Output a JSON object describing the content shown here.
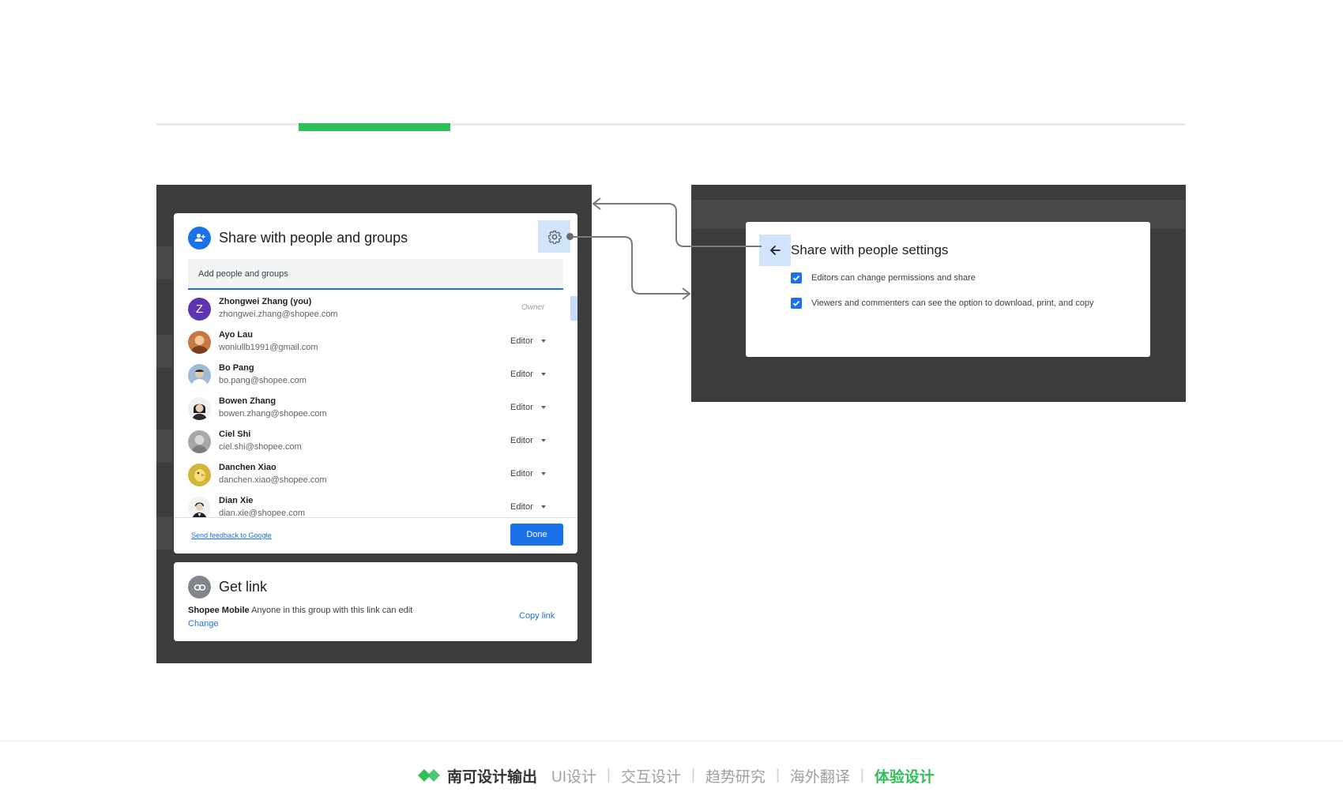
{
  "share_dialog": {
    "title": "Share with people and groups",
    "add_placeholder": "Add people and groups",
    "people": [
      {
        "name": "Zhongwei Zhang (you)",
        "email": "zhongwei.zhang@shopee.com",
        "role": "Owner",
        "avatar_letter": "Z",
        "avatar_color": "#5e35b1"
      },
      {
        "name": "Ayo Lau",
        "email": "woniullb1991@gmail.com",
        "role": "Editor",
        "avatar_color": "#c8773e"
      },
      {
        "name": "Bo Pang",
        "email": "bo.pang@shopee.com",
        "role": "Editor",
        "avatar_color": "#9fbcd6"
      },
      {
        "name": "Bowen Zhang",
        "email": "bowen.zhang@shopee.com",
        "role": "Editor",
        "avatar_color": "#2b2b2b"
      },
      {
        "name": "Ciel Shi",
        "email": "ciel.shi@shopee.com",
        "role": "Editor",
        "avatar_color": "#a8a8a8"
      },
      {
        "name": "Danchen Xiao",
        "email": "danchen.xiao@shopee.com",
        "role": "Editor",
        "avatar_color": "#d4b43a"
      },
      {
        "name": "Dian Xie",
        "email": "dian.xie@shopee.com",
        "role": "Editor",
        "avatar_color": "#1f1f1f"
      }
    ],
    "feedback_link": "Send feedback to Google",
    "done_label": "Done"
  },
  "get_link": {
    "title": "Get link",
    "group_name": "Shopee Mobile",
    "description": "Anyone in this group with this link can edit",
    "change_label": "Change",
    "copy_label": "Copy link"
  },
  "settings_dialog": {
    "title": "Share with people settings",
    "options": [
      {
        "label": "Editors can change permissions and share",
        "checked": true
      },
      {
        "label": "Viewers and commenters can see the option to download, print, and copy",
        "checked": true
      }
    ]
  },
  "footer": {
    "brand": "南可设计输出",
    "items": [
      "UI设计",
      "交互设计",
      "趋势研究",
      "海外翻译"
    ],
    "active": "体验设计",
    "brand_color": "#2fbf58"
  },
  "colors": {
    "accent": "#1a73e8",
    "panel_bg": "#3c3c3c",
    "highlight": "#d2e3fc"
  }
}
